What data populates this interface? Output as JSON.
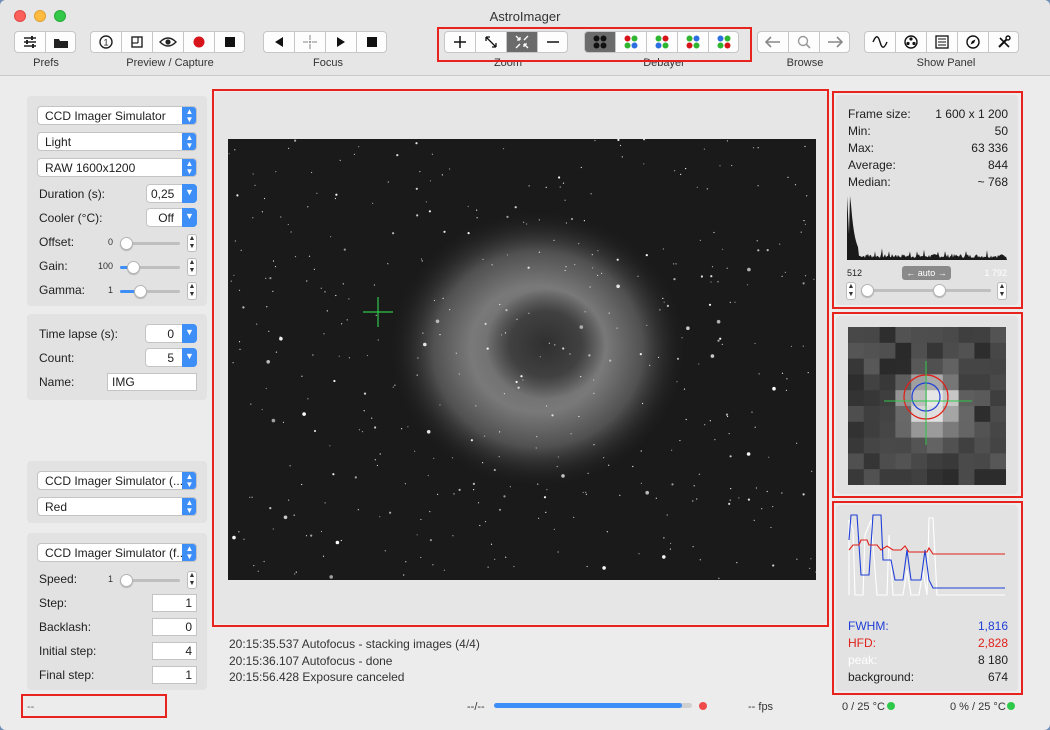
{
  "window": {
    "title": "AstroImager"
  },
  "toolbar": {
    "groups": {
      "prefs": "Prefs",
      "preview_capture": "Preview / Capture",
      "focus": "Focus",
      "zoom": "Zoom",
      "debayer": "Debayer",
      "browse": "Browse",
      "show_panel": "Show Panel"
    }
  },
  "left_panel": {
    "camera": "CCD Imager Simulator",
    "frame_type": "Light",
    "format": "RAW 1600x1200",
    "duration_label": "Duration (s):",
    "duration_value": "0,25",
    "cooler_label": "Cooler (°C):",
    "cooler_value": "Off",
    "offset_label": "Offset:",
    "offset_value": "0",
    "offset_level": 0.0,
    "gain_label": "Gain:",
    "gain_value": "100",
    "gain_level": 0.15,
    "gamma_label": "Gamma:",
    "gamma_value": "1",
    "gamma_level": 0.3,
    "time_lapse_label": "Time lapse (s):",
    "time_lapse_value": "0",
    "count_label": "Count:",
    "count_value": "5",
    "name_label": "Name:",
    "name_value": "IMG",
    "filter_wheel": "CCD Imager Simulator (...",
    "filter": "Red",
    "focuser": "CCD Imager Simulator (f...",
    "speed_label": "Speed:",
    "speed_value": "1",
    "speed_level": 0.0,
    "step_label": "Step:",
    "step_value": "1",
    "backlash_label": "Backlash:",
    "backlash_value": "0",
    "initial_step_label": "Initial step:",
    "initial_step_value": "4",
    "final_step_label": "Final step:",
    "final_step_value": "1"
  },
  "stats": {
    "frame_size_label": "Frame size:",
    "frame_size_value": "1 600 x 1 200",
    "min_label": "Min:",
    "min_value": "50",
    "max_label": "Max:",
    "max_value": "63 336",
    "average_label": "Average:",
    "average_value": "844",
    "median_label": "Median:",
    "median_value": "~ 768",
    "hist_low": "512",
    "hist_auto": "← auto →",
    "hist_high": "1 792"
  },
  "focus_stats": {
    "fwhm_label": "FWHM:",
    "fwhm_value": "1,816",
    "hfd_label": "HFD:",
    "hfd_value": "2,828",
    "peak_label": "peak:",
    "peak_value": "8 180",
    "background_label": "background:",
    "background_value": "674"
  },
  "log": {
    "lines": [
      "20:15:35.537 Autofocus - stacking images (4/4)",
      "20:15:36.107 Autofocus - done",
      "20:15:56.428 Exposure canceled"
    ]
  },
  "status": {
    "left": "--",
    "progress_text": "--/--",
    "progress": 0.95,
    "fps": "-- fps",
    "temp1": "0 / 25 °C",
    "temp2": "0 % / 25 °C"
  },
  "colors": {
    "highlight": "#e8231d",
    "accent": "#3e8ef7",
    "fwhm": "#1f3fd6",
    "hfd": "#e0201a",
    "status_green": "#2ec84a",
    "status_red": "#f04a4a"
  }
}
